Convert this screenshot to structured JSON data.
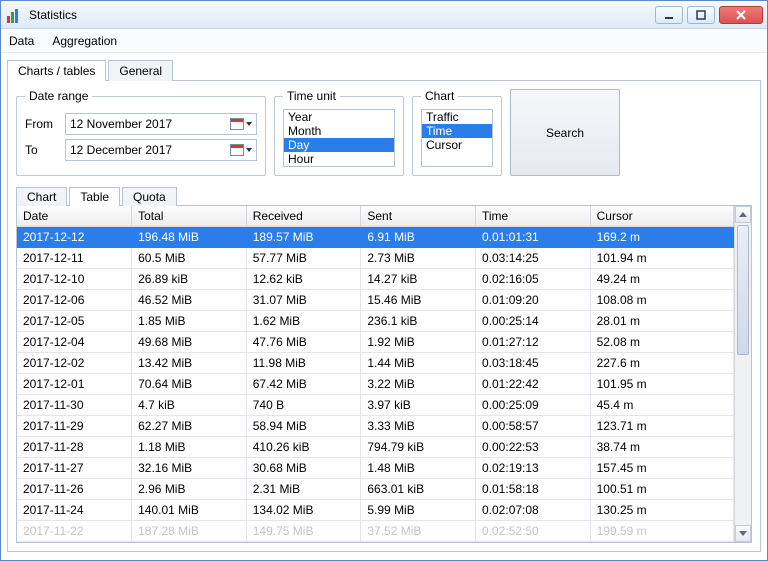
{
  "window": {
    "title": "Statistics"
  },
  "menu": {
    "data": "Data",
    "aggregation": "Aggregation"
  },
  "outer_tabs": {
    "charts": "Charts / tables",
    "general": "General"
  },
  "date_range": {
    "legend": "Date range",
    "from_label": "From",
    "to_label": "To",
    "from_value": "12 November 2017",
    "to_value": "12 December 2017"
  },
  "time_unit": {
    "legend": "Time unit",
    "options": [
      "Year",
      "Month",
      "Day",
      "Hour"
    ],
    "selected": "Day"
  },
  "chart_select": {
    "legend": "Chart",
    "options": [
      "Traffic",
      "Time",
      "Cursor"
    ],
    "selected": "Time"
  },
  "search_label": "Search",
  "inner_tabs": {
    "chart": "Chart",
    "table": "Table",
    "quota": "Quota"
  },
  "table": {
    "columns": [
      "Date",
      "Total",
      "Received",
      "Sent",
      "Time",
      "Cursor"
    ],
    "selected_index": 0,
    "rows": [
      [
        "2017-12-12",
        "196.48 MiB",
        "189.57 MiB",
        "6.91 MiB",
        "0.01:01:31",
        "169.2 m"
      ],
      [
        "2017-12-11",
        "60.5 MiB",
        "57.77 MiB",
        "2.73 MiB",
        "0.03:14:25",
        "101.94 m"
      ],
      [
        "2017-12-10",
        "26.89 kiB",
        "12.62 kiB",
        "14.27 kiB",
        "0.02:16:05",
        "49.24 m"
      ],
      [
        "2017-12-06",
        "46.52 MiB",
        "31.07 MiB",
        "15.46 MiB",
        "0.01:09:20",
        "108.08 m"
      ],
      [
        "2017-12-05",
        "1.85 MiB",
        "1.62 MiB",
        "236.1 kiB",
        "0.00:25:14",
        "28.01 m"
      ],
      [
        "2017-12-04",
        "49.68 MiB",
        "47.76 MiB",
        "1.92 MiB",
        "0.01:27:12",
        "52.08 m"
      ],
      [
        "2017-12-02",
        "13.42 MiB",
        "11.98 MiB",
        "1.44 MiB",
        "0.03:18:45",
        "227.6 m"
      ],
      [
        "2017-12-01",
        "70.64 MiB",
        "67.42 MiB",
        "3.22 MiB",
        "0.01:22:42",
        "101.95 m"
      ],
      [
        "2017-11-30",
        "4.7 kiB",
        "740 B",
        "3.97 kiB",
        "0.00:25:09",
        "45.4 m"
      ],
      [
        "2017-11-29",
        "62.27 MiB",
        "58.94 MiB",
        "3.33 MiB",
        "0.00:58:57",
        "123.71 m"
      ],
      [
        "2017-11-28",
        "1.18 MiB",
        "410.26 kiB",
        "794.79 kiB",
        "0.00:22:53",
        "38.74 m"
      ],
      [
        "2017-11-27",
        "32.16 MiB",
        "30.68 MiB",
        "1.48 MiB",
        "0.02:19:13",
        "157.45 m"
      ],
      [
        "2017-11-26",
        "2.96 MiB",
        "2.31 MiB",
        "663.01 kiB",
        "0.01:58:18",
        "100.51 m"
      ],
      [
        "2017-11-24",
        "140.01 MiB",
        "134.02 MiB",
        "5.99 MiB",
        "0.02:07:08",
        "130.25 m"
      ],
      [
        "2017-11-22",
        "187.28 MiB",
        "149.75 MiB",
        "37.52 MiB",
        "0.02:52:50",
        "199.59 m"
      ]
    ]
  }
}
